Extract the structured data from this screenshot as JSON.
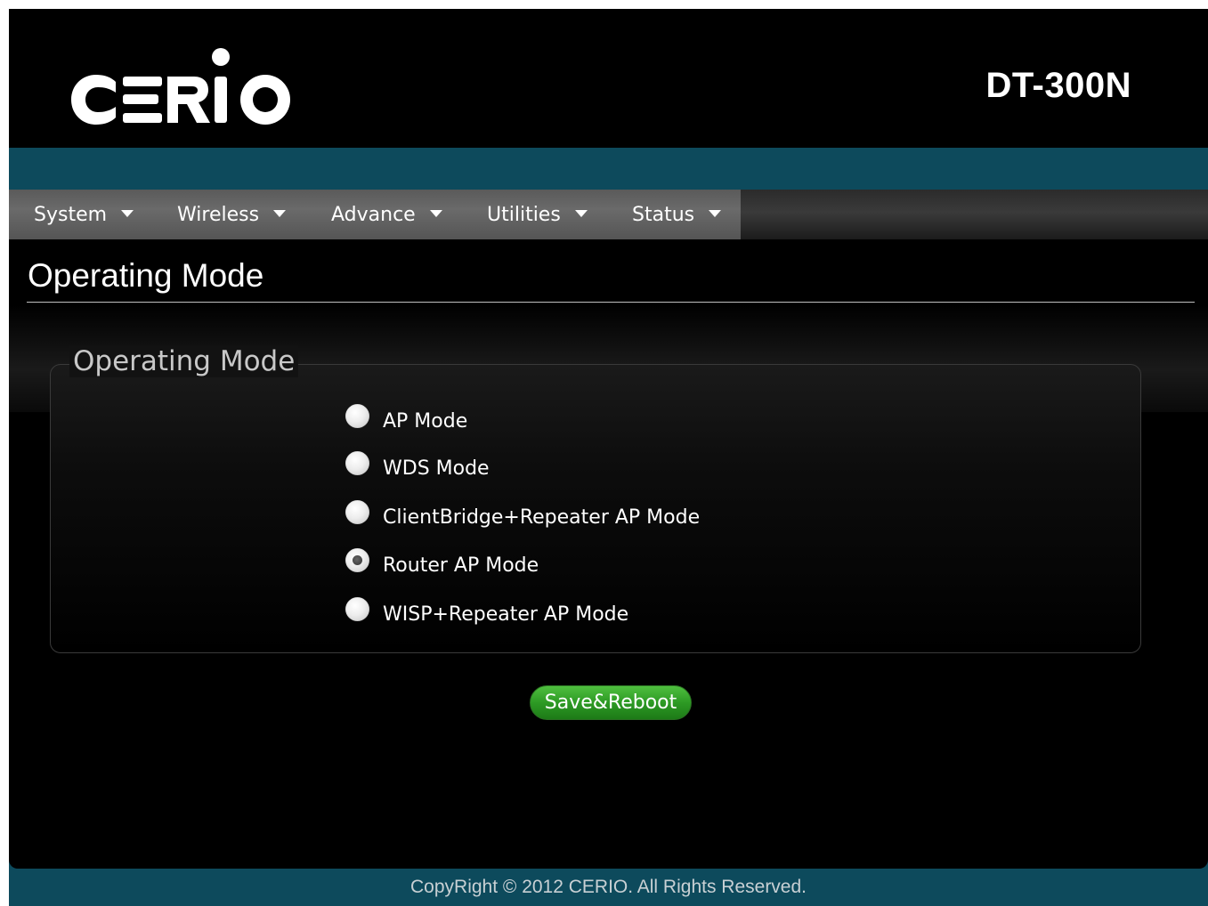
{
  "brand": {
    "logo_text": "CERIO",
    "model": "DT-300N"
  },
  "menu": {
    "items": [
      {
        "label": "System"
      },
      {
        "label": "Wireless"
      },
      {
        "label": "Advance"
      },
      {
        "label": "Utilities"
      },
      {
        "label": "Status"
      }
    ]
  },
  "page": {
    "title": "Operating Mode"
  },
  "operating_mode": {
    "legend": "Operating Mode",
    "options": [
      {
        "label": "AP Mode",
        "selected": false
      },
      {
        "label": "WDS Mode",
        "selected": false
      },
      {
        "label": "ClientBridge+Repeater AP Mode",
        "selected": false
      },
      {
        "label": "Router AP Mode",
        "selected": true
      },
      {
        "label": "WISP+Repeater AP Mode",
        "selected": false
      }
    ],
    "save_label": "Save&Reboot"
  },
  "footer": {
    "copyright": "CopyRight © 2012 CERIO. All Rights Reserved."
  },
  "colors": {
    "header_bg": "#000000",
    "accent_teal": "#0d4a5c",
    "menu_gray": "#5f5f5f",
    "button_green": "#2d9a24"
  }
}
